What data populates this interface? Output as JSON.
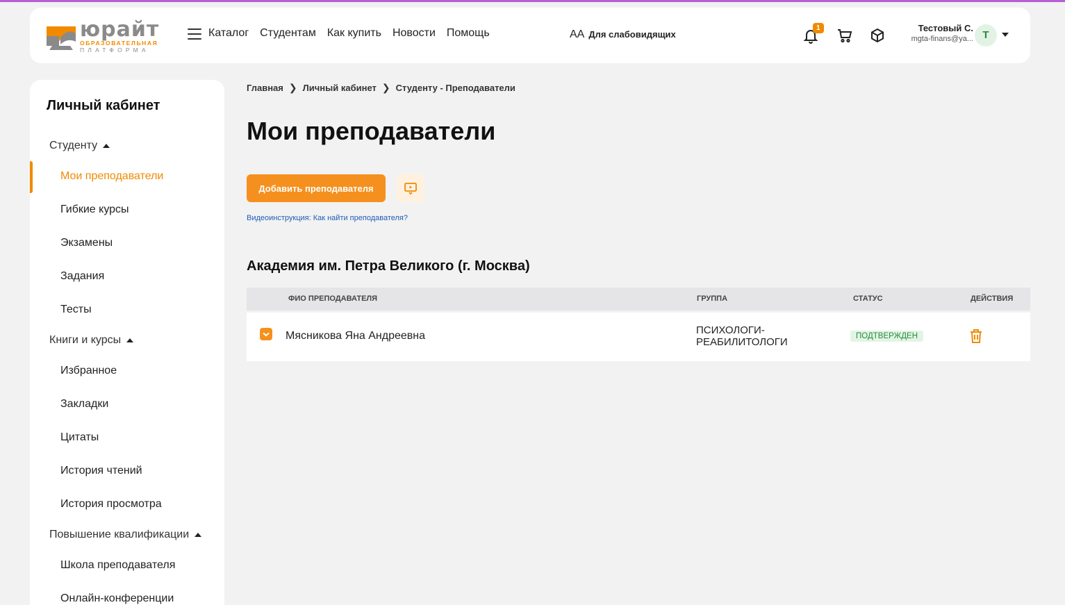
{
  "brand": {
    "name": "юрайт",
    "tagline_1": "ОБРАЗОВАТЕЛЬНАЯ",
    "tagline_2": "ПЛАТФОРМА",
    "accent": "#f18a00"
  },
  "header": {
    "nav": [
      "Каталог",
      "Студентам",
      "Как купить",
      "Новости",
      "Помощь"
    ],
    "accessibility_icon": "АA",
    "accessibility_label": "Для слабовидящих",
    "notifications_count": "1",
    "user_name": "Тестовый С.",
    "user_email": "mgta-finans@ya...",
    "avatar_letter": "Т"
  },
  "sidebar": {
    "title": "Личный кабинет",
    "sections": [
      {
        "label": "Студенту",
        "items": [
          "Мои преподаватели",
          "Гибкие курсы",
          "Экзамены",
          "Задания",
          "Тесты"
        ]
      },
      {
        "label": "Книги и курсы",
        "items": [
          "Избранное",
          "Закладки",
          "Цитаты",
          "История чтений",
          "История просмотра"
        ]
      },
      {
        "label": "Повышение квалификации",
        "items": [
          "Школа преподавателя",
          "Онлайн-конференции"
        ]
      }
    ],
    "active_item": "Мои преподаватели"
  },
  "breadcrumb": [
    "Главная",
    "Личный кабинет",
    "Студенту - Преподаватели"
  ],
  "main": {
    "title": "Мои преподаватели",
    "add_button": "Добавить преподавателя",
    "video_link": "Видеоинструкция: Как найти преподавателя?",
    "org_title": "Академия им. Петра Великого (г. Москва)",
    "table": {
      "headers": [
        "ФИО ПРЕПОДАВАТЕЛЯ",
        "ГРУППА",
        "СТАТУС",
        "ДЕЙСТВИЯ"
      ],
      "rows": [
        {
          "name": "Мясникова Яна Андреевна",
          "group_line1": "ПСИХОЛОГИ-",
          "group_line2": "РЕАБИЛИТОЛОГИ",
          "status": "ПОДТВЕРЖДЕН"
        }
      ]
    }
  }
}
